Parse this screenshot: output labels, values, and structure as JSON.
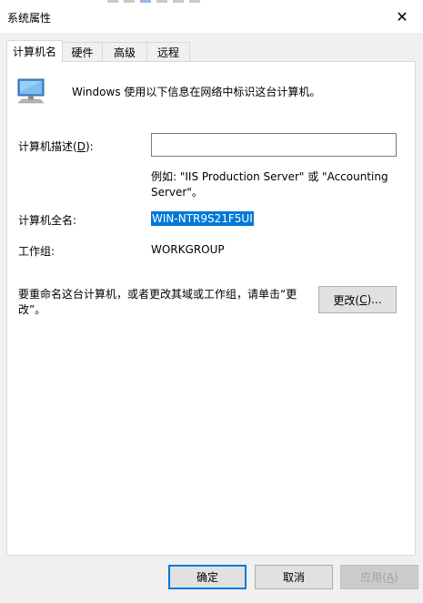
{
  "window": {
    "title": "系统属性",
    "close_glyph": "✕"
  },
  "tabs": [
    {
      "label": "计算机名",
      "active": true
    },
    {
      "label": "硬件",
      "active": false
    },
    {
      "label": "高级",
      "active": false
    },
    {
      "label": "远程",
      "active": false
    }
  ],
  "computer_name": {
    "intro": "Windows 使用以下信息在网络中标识这台计算机。",
    "description_label_pre": "计算机描述(",
    "description_label_key": "D",
    "description_label_post": "):",
    "description_value": "",
    "example_text": "例如: \"IIS Production Server\" 或 \"Accounting Server\"。",
    "fullname_label": "计算机全名:",
    "fullname_value": "WIN-NTR9S21F5UI",
    "workgroup_label": "工作组:",
    "workgroup_value": "WORKGROUP",
    "rename_text": "要重命名这台计算机，或者更改其域或工作组，请单击“更改”。",
    "change_button_pre": "更改(",
    "change_button_key": "C",
    "change_button_post": ")..."
  },
  "footer": {
    "ok_label": "确定",
    "cancel_label": "取消",
    "apply_pre": "应用(",
    "apply_key": "A",
    "apply_post": ")"
  },
  "colors": {
    "selection": "#0078d7",
    "dialog_bg": "#f0f0f0"
  }
}
